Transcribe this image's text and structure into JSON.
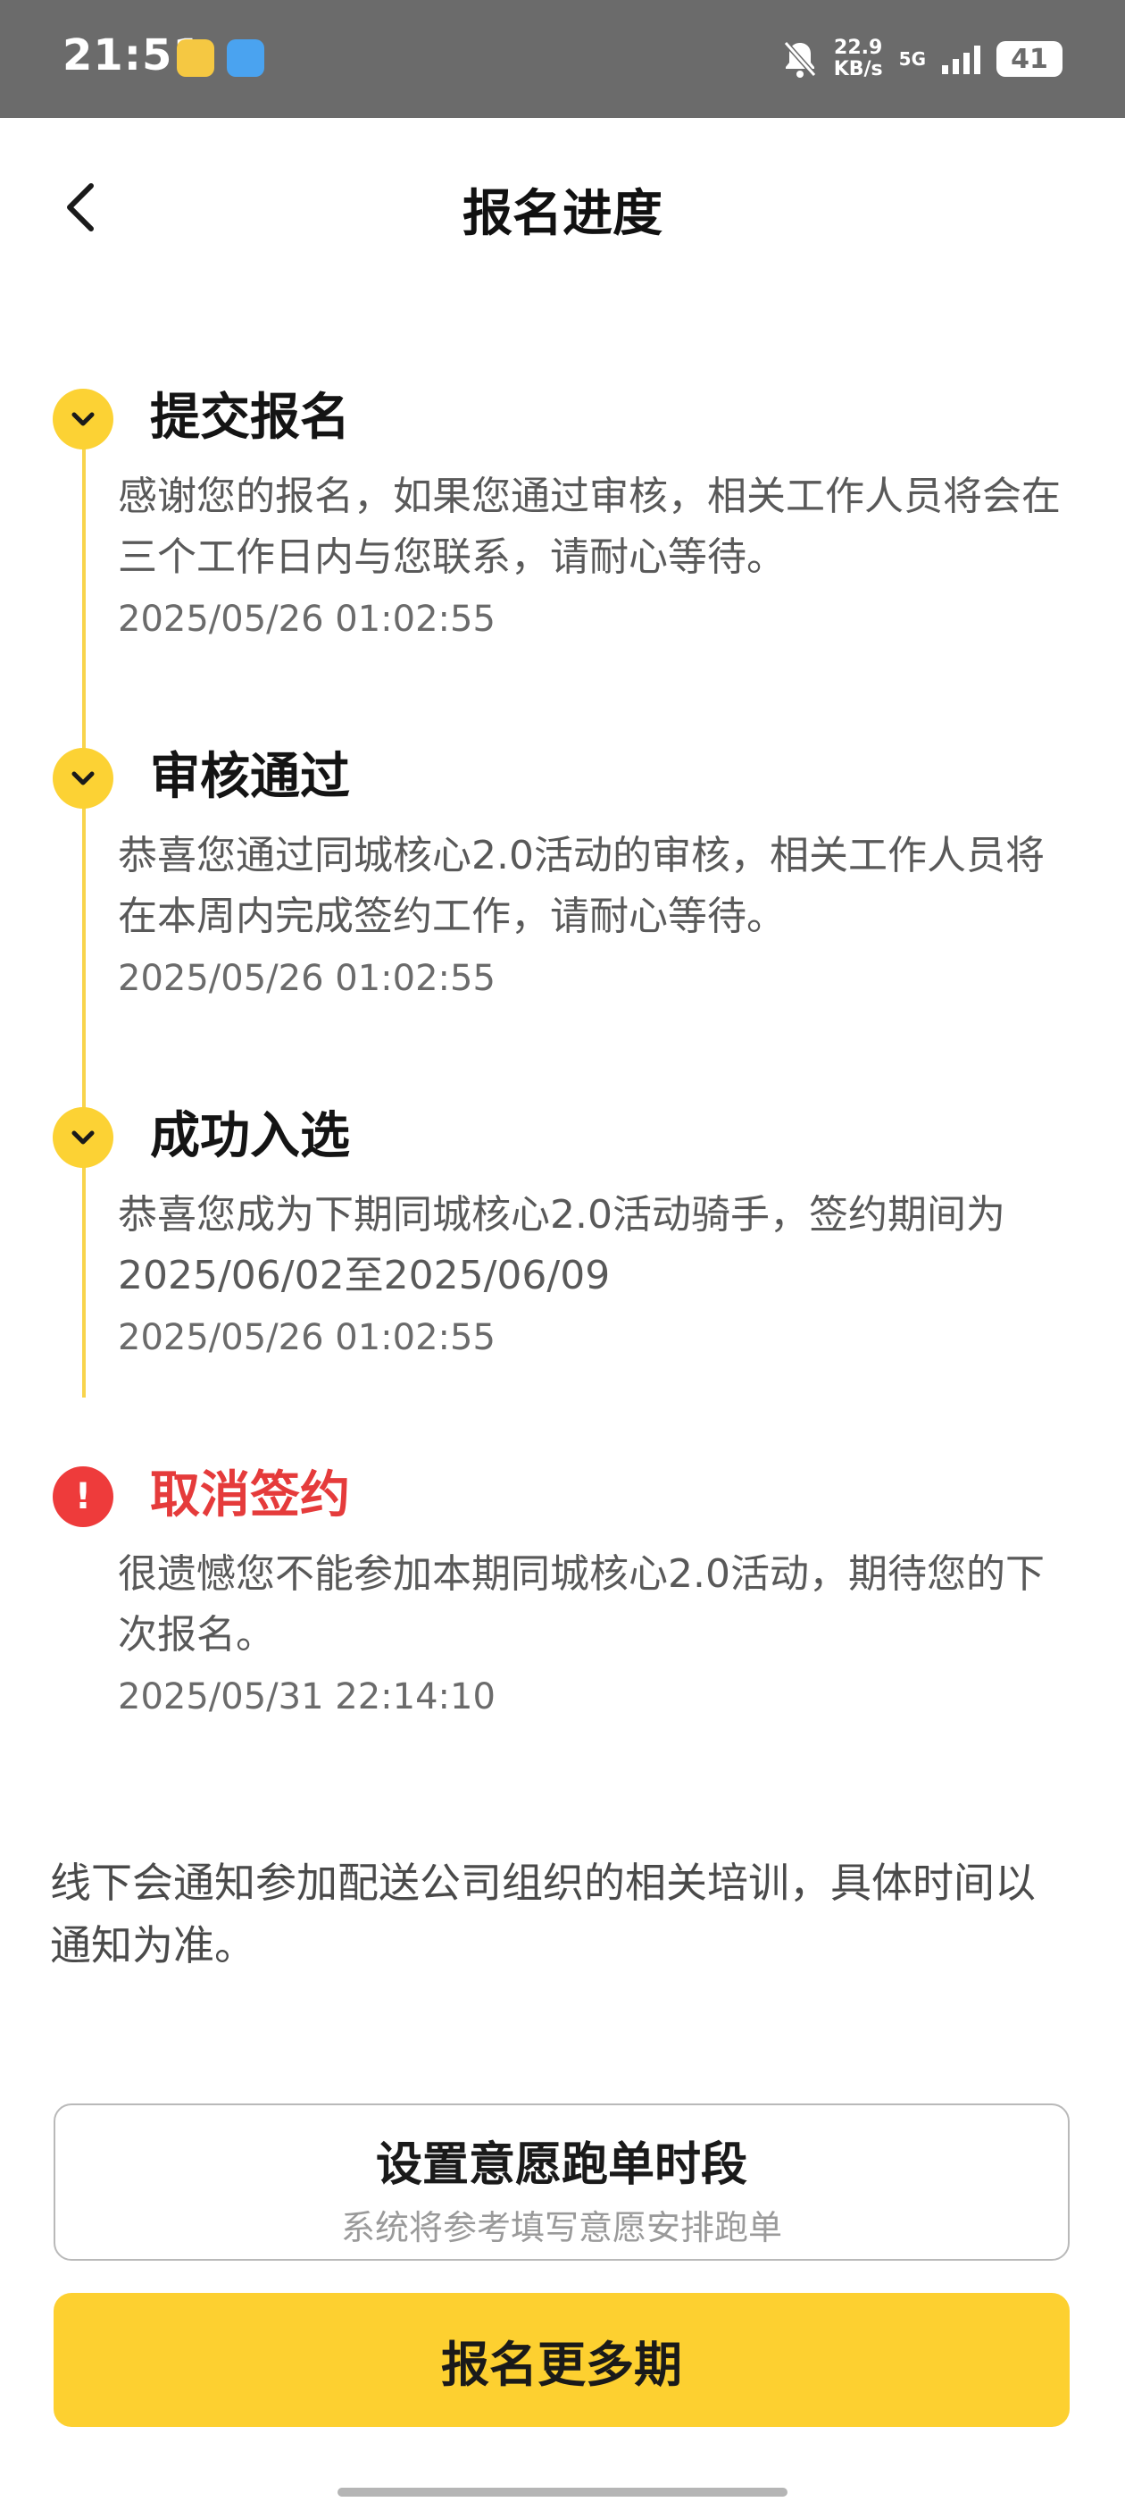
{
  "status_bar": {
    "time": "21:51",
    "net_speed_value": "22.9",
    "net_speed_unit": "KB/s",
    "network_type": "5G",
    "battery": "41",
    "icons": [
      "app-icon",
      "weather-icon",
      "bell-mute-icon",
      "signal-icon",
      "battery-icon"
    ]
  },
  "header": {
    "title": "报名进度",
    "back_icon": "chevron-left-icon"
  },
  "steps": [
    {
      "title": "提交报名",
      "description": "感谢您的报名，如果您通过审核，相关工作人员将会在三个工作日内与您联系，请耐心等待。",
      "time": "2025/05/26 01:02:55",
      "status": "done",
      "icon": "chevron-down-icon"
    },
    {
      "title": "审核通过",
      "description": "恭喜您通过同城核心2.0活动的审核，相关工作人员将在本周内完成签约工作，请耐心等待。",
      "time": "2025/05/26 01:02:55",
      "status": "done",
      "icon": "chevron-down-icon"
    },
    {
      "title": "成功入选",
      "description": "恭喜您成为下期同城核心2.0活动骑手，签约期间为2025/06/02至2025/06/09",
      "time": "2025/05/26 01:02:55",
      "status": "done",
      "icon": "chevron-down-icon"
    },
    {
      "title": "取消签约",
      "description": "很遗憾您不能参加本期同城核心2.0活动，期待您的下次报名。",
      "time": "2025/05/31 22:14:10",
      "status": "error",
      "icon": "exclamation-icon",
      "icon_text": "!"
    }
  ],
  "notice": "线下会通知参加配送公司组织的相关培训，具体时间以通知为准。",
  "buttons": {
    "set_time": {
      "label": "设置意愿跑单时段",
      "sublabel": "系统将参考填写意愿安排跑单"
    },
    "register_more": {
      "label": "报名更多期"
    }
  },
  "colors": {
    "accent_yellow": "#FCD234",
    "error_red": "#E53B3B",
    "status_bar_bg": "#6B6B6B"
  }
}
